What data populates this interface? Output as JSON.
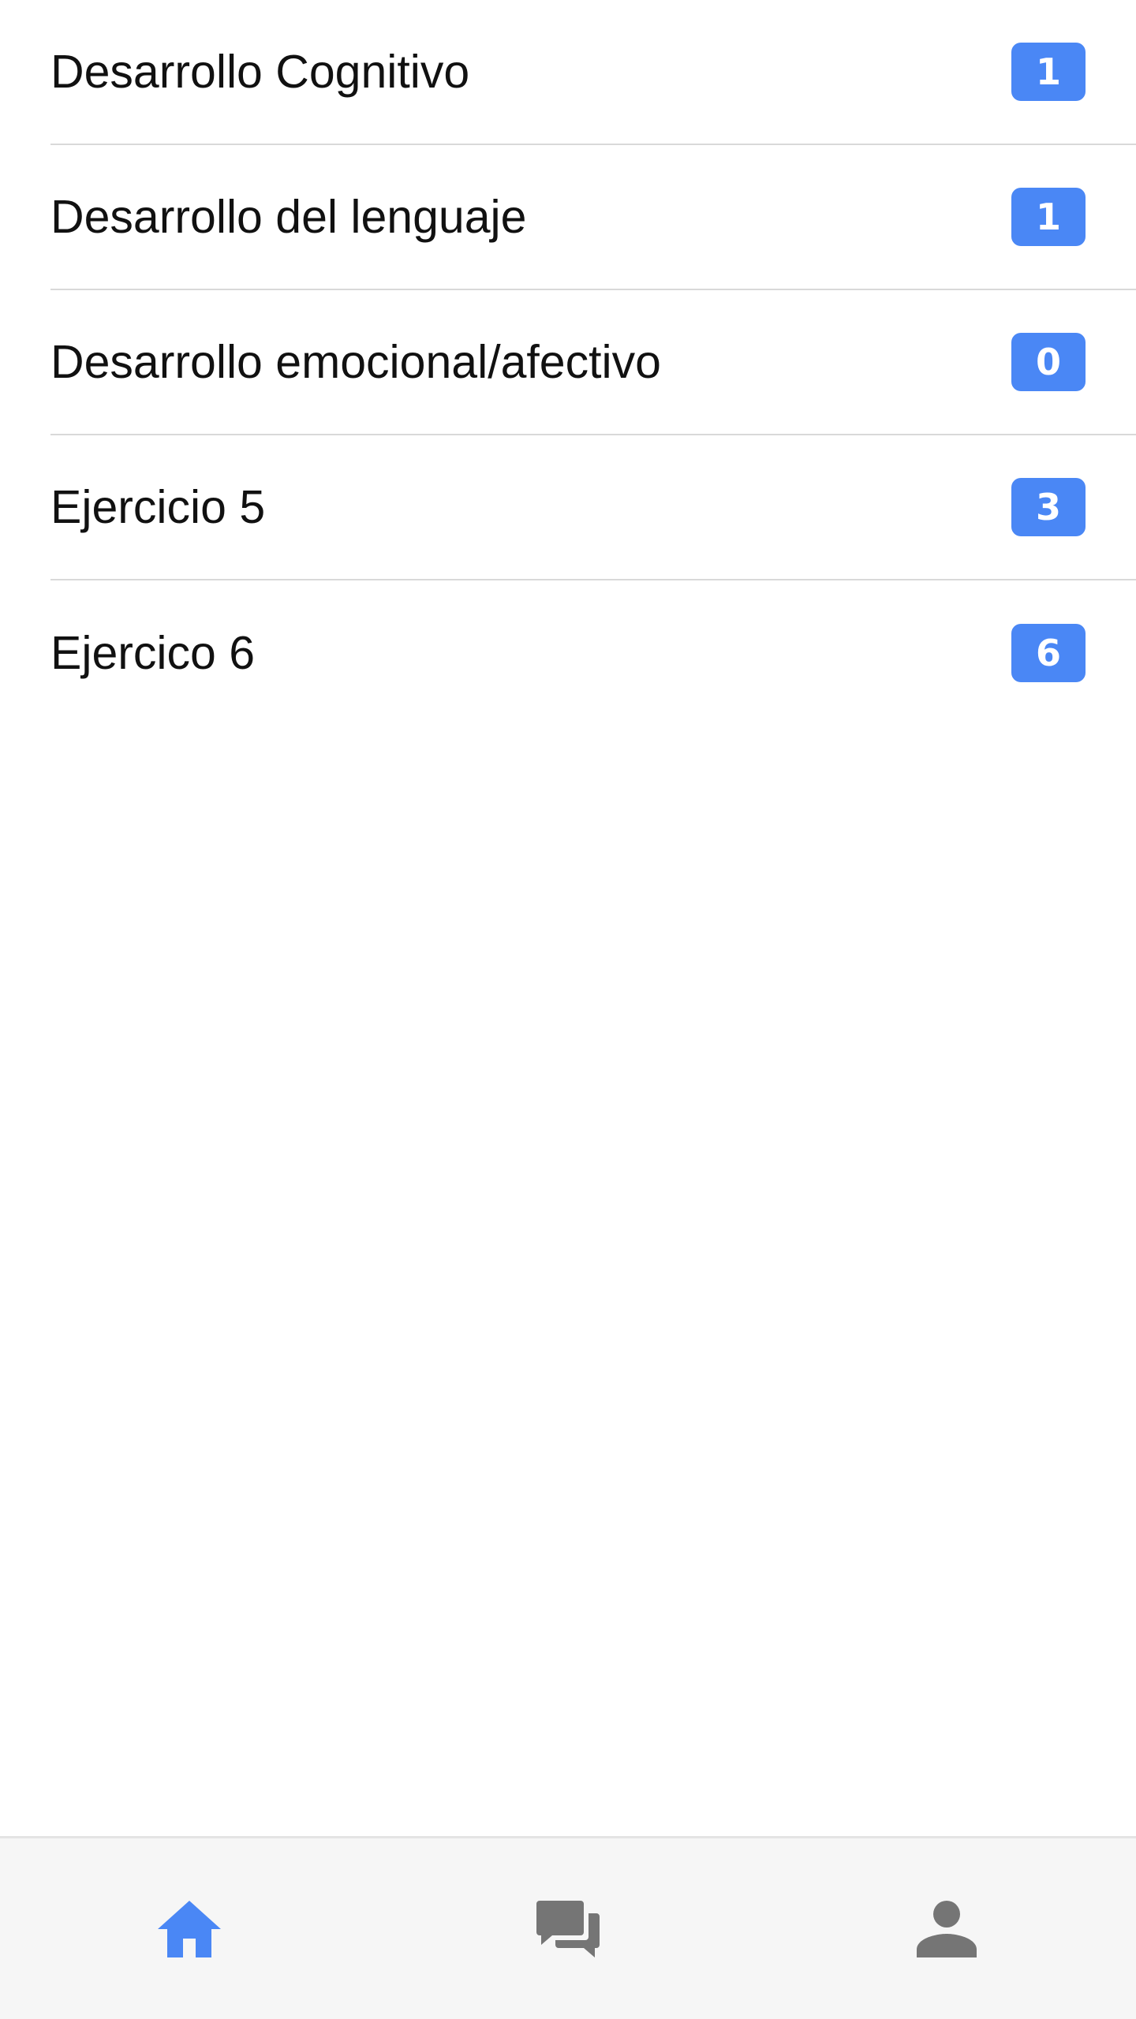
{
  "list": {
    "items": [
      {
        "label": "Desarrollo Cognitivo",
        "count": "1"
      },
      {
        "label": "Desarrollo del lenguaje",
        "count": "1"
      },
      {
        "label": "Desarrollo emocional/afectivo",
        "count": "0"
      },
      {
        "label": "Ejercicio 5",
        "count": "3"
      },
      {
        "label": "Ejercico 6",
        "count": "6"
      }
    ]
  },
  "tabbar": {
    "tabs": [
      {
        "icon": "home-icon",
        "active": true
      },
      {
        "icon": "chat-icon",
        "active": false
      },
      {
        "icon": "person-icon",
        "active": false
      }
    ]
  },
  "colors": {
    "accent": "#4a87f5",
    "icon_inactive": "#757575",
    "tabbar_bg": "#f6f6f6"
  }
}
